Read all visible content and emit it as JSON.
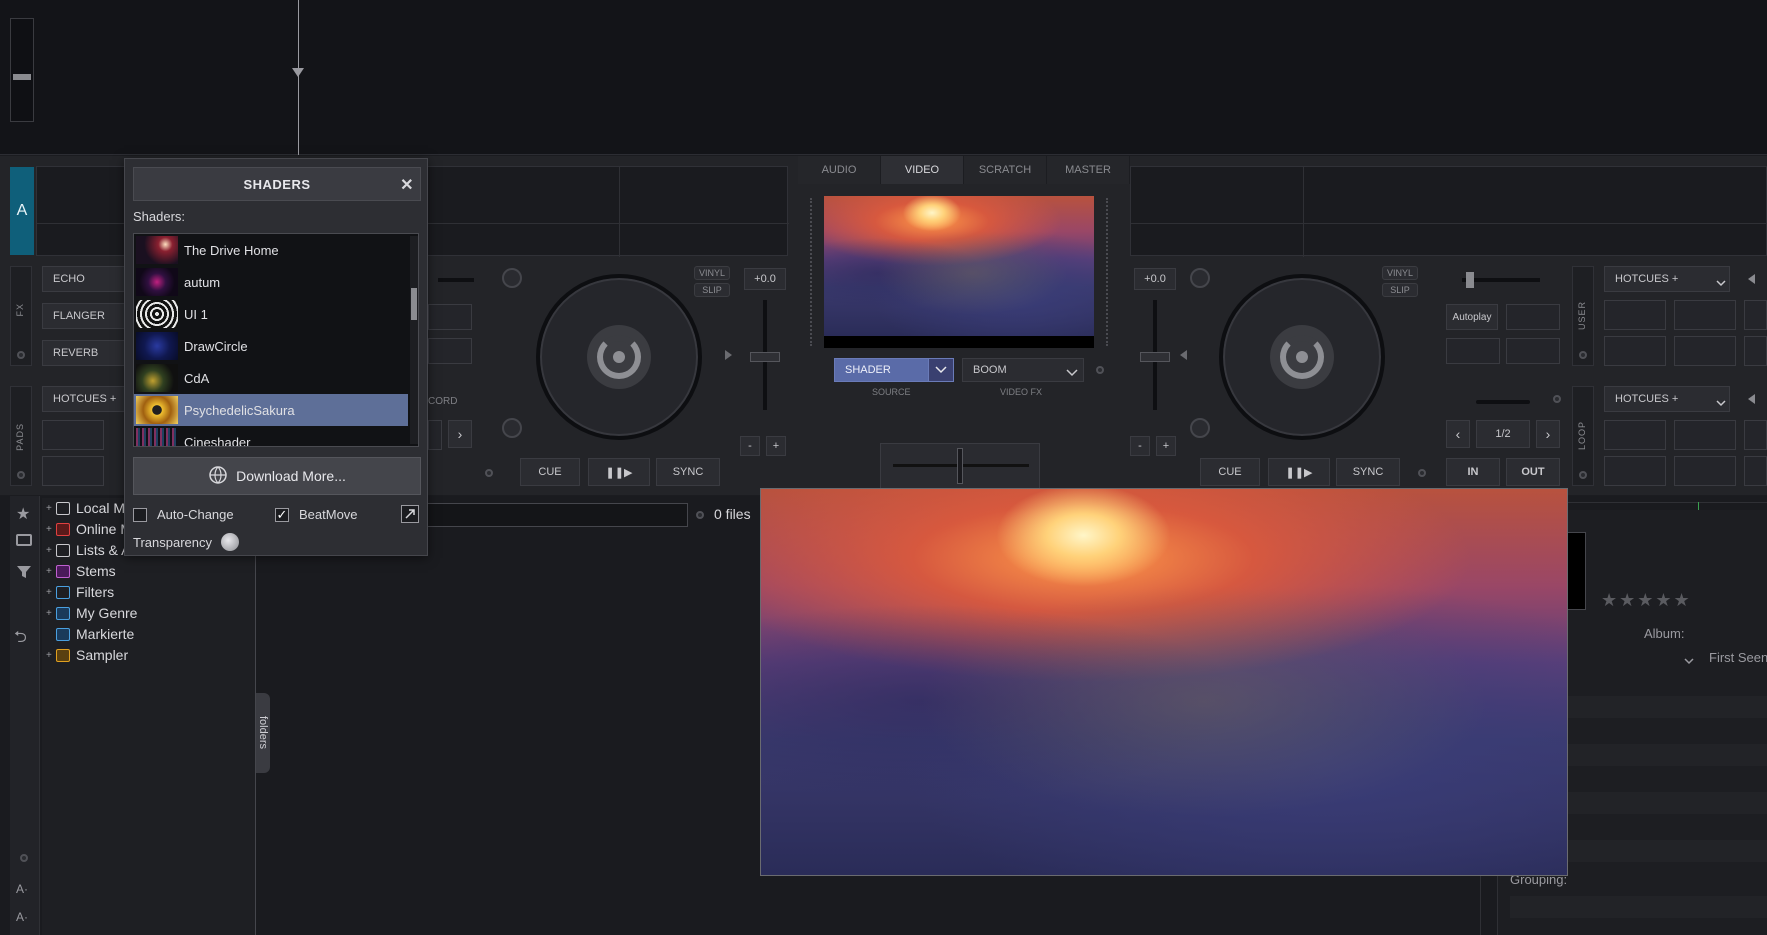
{
  "deck_a": {
    "tag": "A",
    "fx": {
      "label": "FX",
      "items": [
        "ECHO",
        "FLANGER",
        "REVERB"
      ]
    },
    "pads": {
      "label": "PADS",
      "mode": "HOTCUES +"
    },
    "vinyl": "VINYL",
    "slip": "SLIP",
    "pitch": "+0.0",
    "record_label": "CORD",
    "minus": "-",
    "plus": "+",
    "cue": "CUE",
    "play": "❚❚▶",
    "sync": "SYNC"
  },
  "center": {
    "tabs": [
      {
        "label": "AUDIO",
        "active": false
      },
      {
        "label": "VIDEO",
        "active": true
      },
      {
        "label": "SCRATCH",
        "active": false
      },
      {
        "label": "MASTER",
        "active": false
      }
    ],
    "source_value": "SHADER",
    "source_caption": "SOURCE",
    "fx_value": "BOOM",
    "fx_caption": "VIDEO FX"
  },
  "deck_b": {
    "pitch": "+0.0",
    "vinyl": "VINYL",
    "slip": "SLIP",
    "minus": "-",
    "plus": "+",
    "cue": "CUE",
    "play": "❚❚▶",
    "sync": "SYNC",
    "autoplay": "Autoplay",
    "user_label": "USER",
    "loop_label": "LOOP",
    "hotcues_top": "HOTCUES +",
    "hotcues_bottom": "HOTCUES +",
    "loop_size": "1/2",
    "in": "IN",
    "out": "OUT"
  },
  "browser": {
    "tree": [
      {
        "label": "Local M",
        "icon": "computer-icon",
        "color": "#c8c8cc"
      },
      {
        "label": "Online M",
        "icon": "online-icon",
        "color": "#e04040"
      },
      {
        "label": "Lists & A",
        "icon": "list-icon",
        "color": "#c8c8cc"
      },
      {
        "label": "Stems",
        "icon": "stems-icon",
        "color": "#c060d0"
      },
      {
        "label": "Filters",
        "icon": "filter-icon",
        "color": "#4aa0e0"
      },
      {
        "label": "My Genre",
        "icon": "genre-icon",
        "color": "#4aa0e0"
      },
      {
        "label": "Markierte",
        "icon": "marked-icon",
        "color": "#4aa0e0"
      },
      {
        "label": "Sampler",
        "icon": "sampler-icon",
        "color": "#e0a020"
      }
    ],
    "folders_tab": "folders",
    "files_count": "0 files",
    "info": {
      "album_label": "Album:",
      "first_seen": "First Seen",
      "grouping_label": "Grouping:"
    },
    "side_buttons": [
      "A·",
      "A·"
    ]
  },
  "shaders_dialog": {
    "title": "SHADERS",
    "close": "✕",
    "list_label": "Shaders:",
    "items": [
      {
        "name": "The Drive Home",
        "selected": false
      },
      {
        "name": "autum",
        "selected": false
      },
      {
        "name": "UI 1",
        "selected": false
      },
      {
        "name": "DrawCircle",
        "selected": false
      },
      {
        "name": "CdA",
        "selected": false
      },
      {
        "name": "PsychedelicSakura",
        "selected": true
      },
      {
        "name": "Cineshader",
        "selected": false
      }
    ],
    "download_label": "Download More...",
    "auto_change_label": "Auto-Change",
    "auto_change_checked": false,
    "beatmove_label": "BeatMove",
    "beatmove_checked": true,
    "transparency_label": "Transparency"
  }
}
